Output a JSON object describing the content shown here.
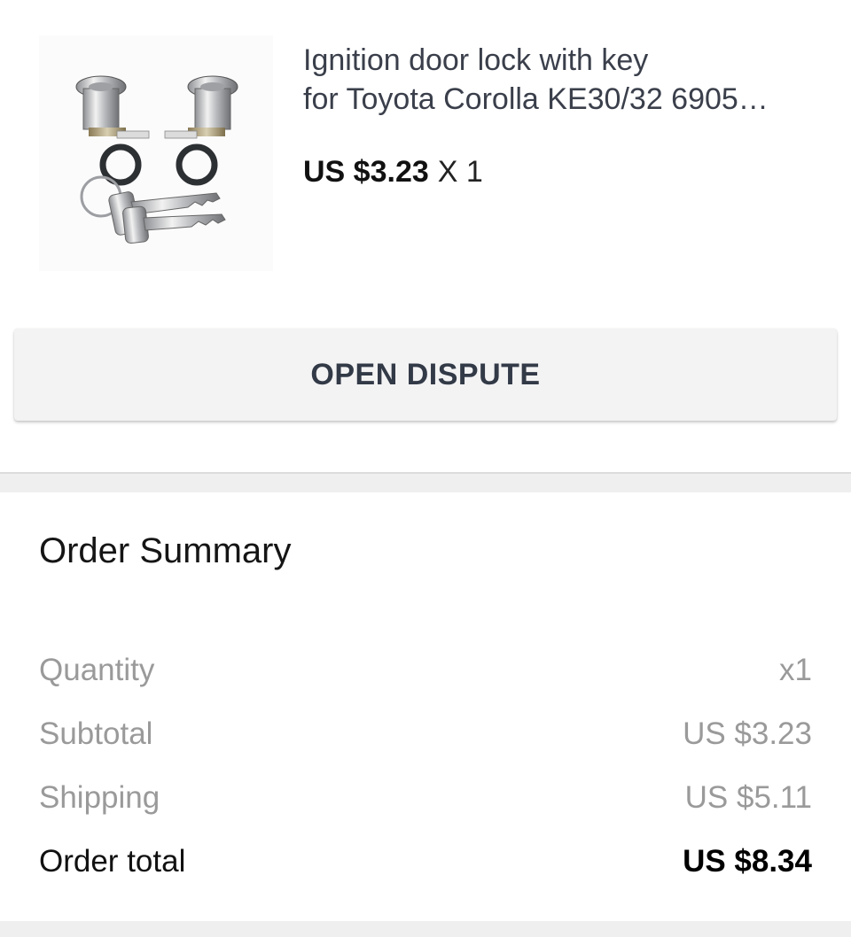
{
  "product": {
    "title": "Ignition door lock with key\nfor Toyota Corolla KE30/32 6905…",
    "price": "US $3.23",
    "quantity": "X 1",
    "image_alt": "Ignition door lock cylinders with key"
  },
  "dispute_button": {
    "label": "OPEN DISPUTE"
  },
  "order_summary": {
    "title": "Order Summary",
    "rows": [
      {
        "label": "Quantity",
        "value": "x1"
      },
      {
        "label": "Subtotal",
        "value": "US $3.23"
      },
      {
        "label": "Shipping",
        "value": "US $5.11"
      },
      {
        "label": "Order total",
        "value": "US $8.34"
      }
    ]
  }
}
